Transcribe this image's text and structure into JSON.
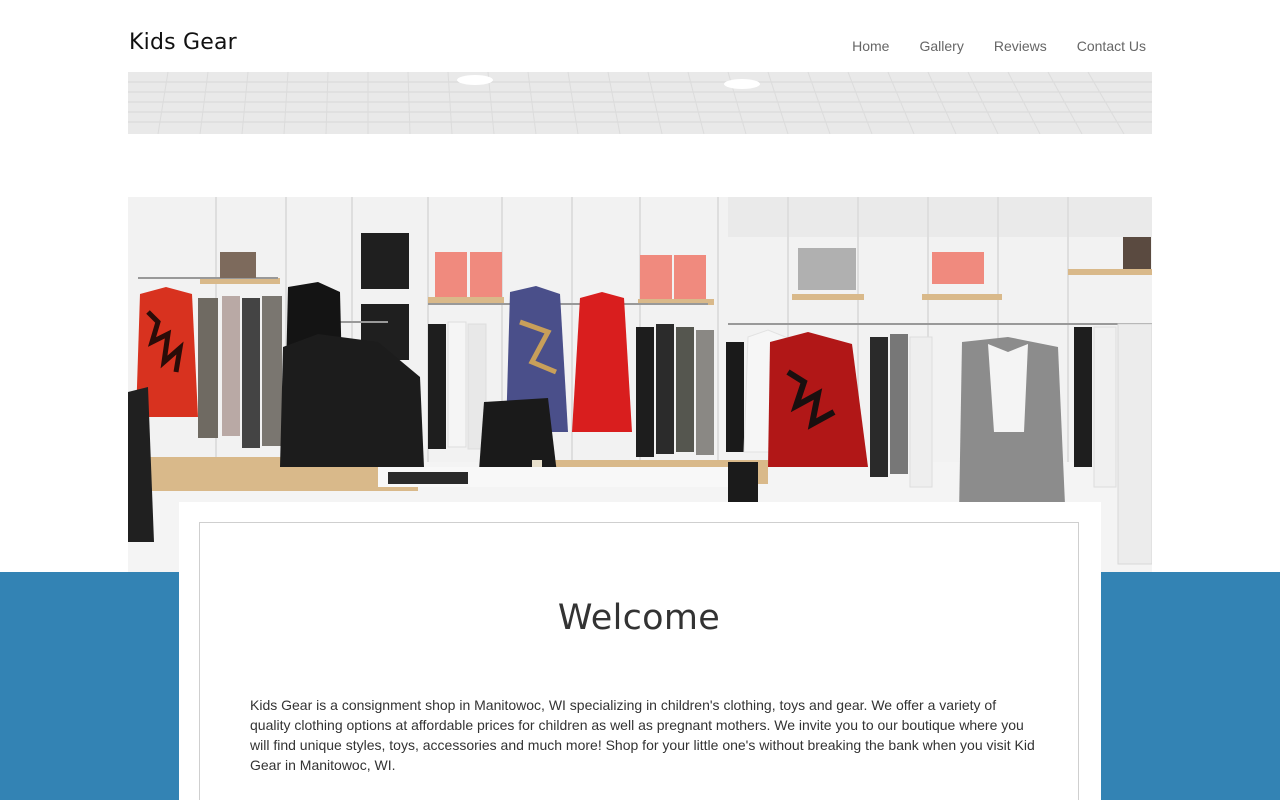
{
  "header": {
    "site_title": "Kids Gear",
    "nav": [
      {
        "label": "Home"
      },
      {
        "label": "Gallery"
      },
      {
        "label": "Reviews"
      },
      {
        "label": "Contact Us"
      }
    ]
  },
  "hero": {
    "image_subject": "boutique-interior-photo"
  },
  "main": {
    "heading": "Welcome",
    "intro": "Kids Gear is a consignment shop in Manitowoc, WI specializing in children's clothing, toys and gear. We offer a variety of quality clothing options at affordable prices for children as well as pregnant mothers. We invite you to our boutique where you will find unique styles, toys, accessories and much more! Shop for your little one's without breaking the bank when you visit Kid Gear in Manitowoc, WI."
  },
  "colors": {
    "band": "#3383b4",
    "text": "#333333",
    "nav_text": "#666666"
  }
}
